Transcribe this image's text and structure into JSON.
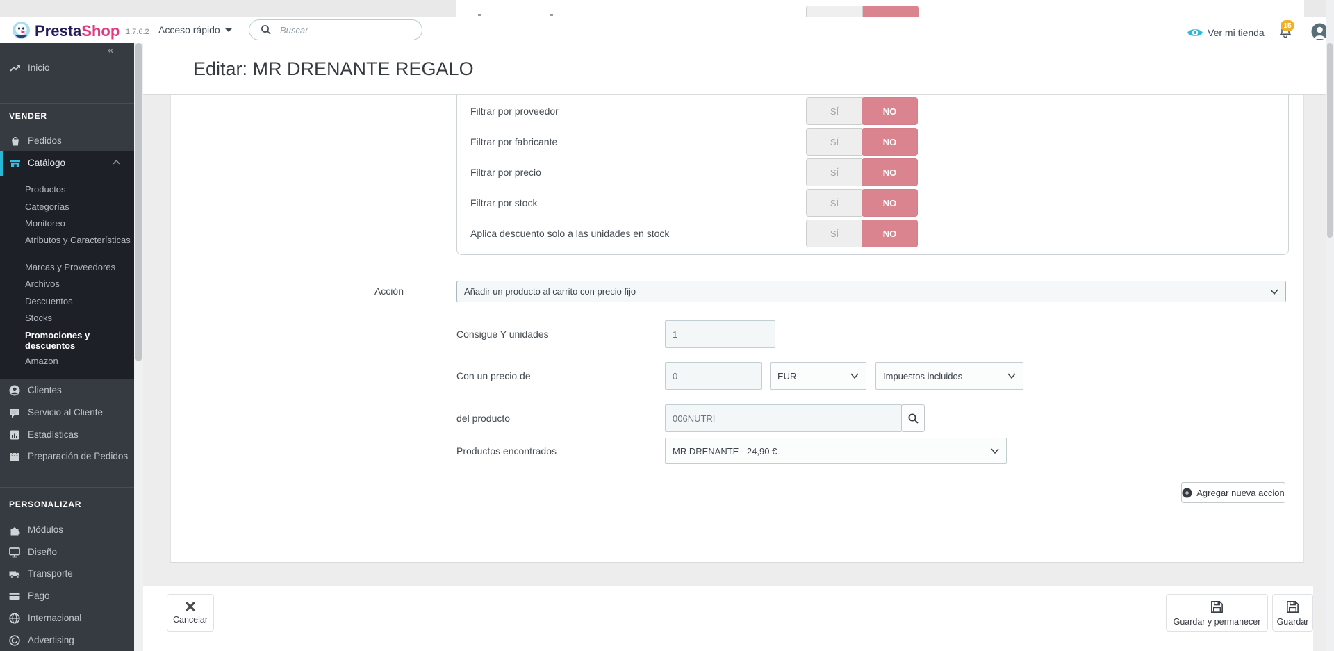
{
  "header": {
    "brand_primary": "Presta",
    "brand_secondary": "Shop",
    "version": "1.7.6.2",
    "quick_access_label": "Acceso rápido",
    "search_placeholder": "Buscar",
    "view_store_label": "Ver mi tienda",
    "notifications_count": "15"
  },
  "page": {
    "title": "Editar: MR DRENANTE REGALO"
  },
  "sidebar": {
    "collapse_glyph": "«",
    "home_label": "Inicio",
    "vender_title": "VENDER",
    "personalizar_title": "PERSONALIZAR",
    "pedidos": "Pedidos",
    "catalogo": "Catálogo",
    "catalog_children": [
      "Productos",
      "Categorías",
      "Monitoreo",
      "Atributos y Características",
      "Marcas y Proveedores",
      "Archivos",
      "Descuentos",
      "Stocks",
      "Promociones y descuentos",
      "Amazon"
    ],
    "clientes": "Clientes",
    "servicio": "Servicio al Cliente",
    "estadisticas": "Estadísticas",
    "preparacion": "Preparación de Pedidos",
    "modulos": "Módulos",
    "diseno": "Diseño",
    "transporte": "Transporte",
    "pago": "Pago",
    "internacional": "Internacional",
    "advertising": "Advertising"
  },
  "form": {
    "toggle_yes": "SÍ",
    "toggle_no": "NO",
    "filter_rows": [
      {
        "label": "Filtrar por proveedor",
        "value": "NO"
      },
      {
        "label": "Filtrar por fabricante",
        "value": "NO"
      },
      {
        "label": "Filtrar por precio",
        "value": "NO"
      },
      {
        "label": "Filtrar por stock",
        "value": "NO"
      },
      {
        "label": "Aplica descuento solo a las unidades en stock",
        "value": "NO"
      }
    ]
  },
  "action": {
    "label": "Acción",
    "value": "Añadir un producto al carrito con precio fijo",
    "rows": [
      {
        "label": "Consigue Y unidades",
        "value": "1"
      },
      {
        "label": "Con un precio de",
        "value": "0",
        "currency": "EUR",
        "tax_mode": "Impuestos incluidos"
      },
      {
        "label": "del producto",
        "value": "006NUTRI"
      },
      {
        "label": "Productos encontrados",
        "value": "MR DRENANTE - 24,90 €"
      }
    ],
    "add_button_label": "Agregar nueva accion"
  },
  "toolbar": {
    "cancel_label": "Cancelar",
    "save_stay_label": "Guardar y permanecer",
    "save_label": "Guardar"
  },
  "colors": {
    "accent_cyan": "#25b9d7",
    "brand_pink": "#e1397c",
    "brand_navy": "#251b5b",
    "toggle_no_red": "#d9848e",
    "badge_orange": "#eeb22e",
    "sidebar_dark": "#363a41",
    "sidebar_submenu_dark": "#1d2127"
  },
  "icons": [
    "prestashop-bird-logo",
    "search-icon",
    "eye-icon",
    "bell-icon",
    "avatar-icon",
    "trending-up-icon",
    "basket-icon",
    "store-icon",
    "person-circle-icon",
    "chat-icon",
    "bar-chart-icon",
    "calendar-icon",
    "puzzle-icon",
    "monitor-icon",
    "truck-icon",
    "credit-card-icon",
    "globe-icon",
    "target-icon",
    "plus-circle-icon",
    "magnifier-icon",
    "x-icon",
    "floppy-icon",
    "chevron-down-icon",
    "chevron-up-icon"
  ]
}
